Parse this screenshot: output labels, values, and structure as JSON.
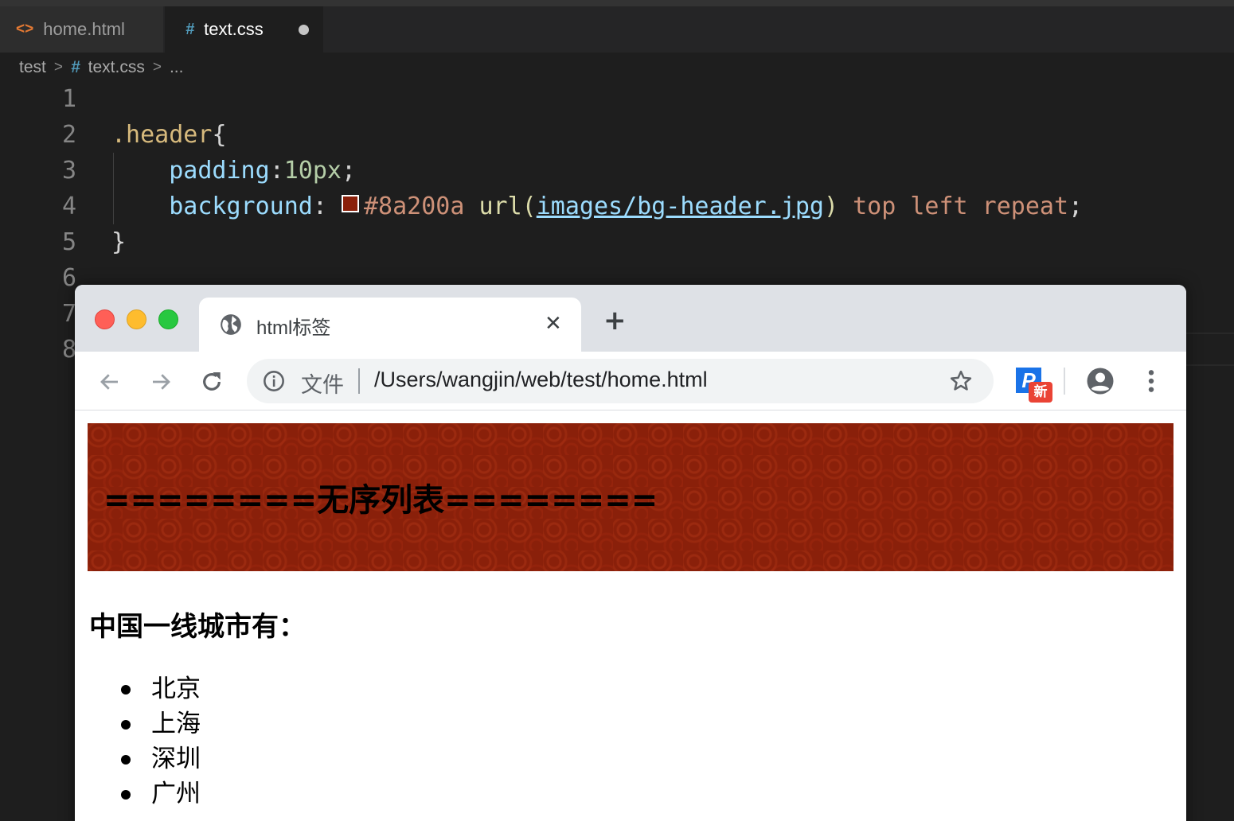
{
  "editor": {
    "tabs": [
      {
        "label": "home.html",
        "icon": "html-file-icon",
        "active": false
      },
      {
        "label": "text.css",
        "icon": "css-file-icon",
        "active": true,
        "modified": true
      }
    ],
    "breadcrumb": {
      "folder": "test",
      "file": "text.css",
      "more": "..."
    },
    "line_numbers": [
      "1",
      "2",
      "3",
      "4",
      "5",
      "6",
      "7",
      "8"
    ],
    "code": {
      "l2_selector": ".header",
      "l2_brace": "{",
      "l3_prop": "padding",
      "l3_colon": ":",
      "l3_value": "10px",
      "l3_semi": ";",
      "l4_prop": "background",
      "l4_colon": ":",
      "l4_color": "#8a200a",
      "l4_fn": "url(",
      "l4_url": "images/bg-header.jpg",
      "l4_fn_close": ")",
      "l4_values": "top left repeat",
      "l4_semi": ";",
      "l5_brace": "}"
    },
    "colors": {
      "swatch": "#8a200a",
      "selector": "#d7ba7d",
      "property": "#9cdcfe",
      "number": "#b5cea8",
      "value": "#ce9178"
    }
  },
  "browser": {
    "tab_title": "html标签",
    "close_glyph": "✕",
    "new_tab_glyph": "+",
    "nav": {
      "back": "←",
      "forward": "→",
      "reload": "reload-icon"
    },
    "omnibox": {
      "scheme_label": "文件",
      "url": "/Users/wangjin/web/test/home.html"
    },
    "extension": {
      "letter": "P",
      "badge": "新"
    },
    "page": {
      "header_text": "========无序列表========",
      "header_bg": "#8a200a",
      "heading": "中国一线城市有：",
      "cities": [
        "北京",
        "上海",
        "深圳",
        "广州"
      ]
    }
  }
}
